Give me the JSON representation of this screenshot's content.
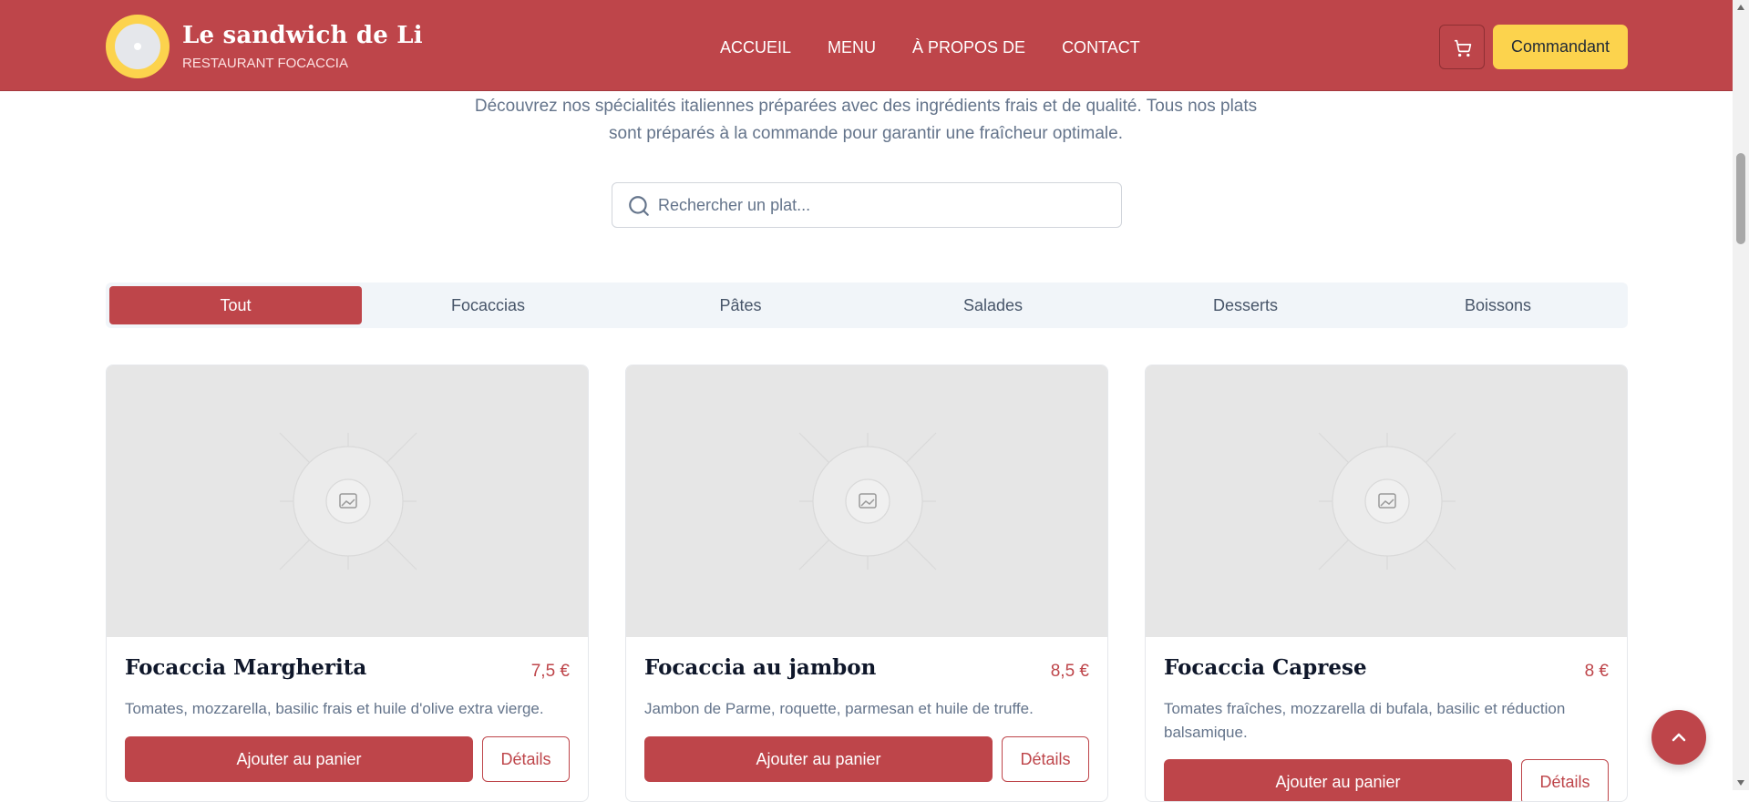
{
  "brand": {
    "title": "Le sandwich de Li",
    "subtitle": "RESTAURANT FOCACCIA"
  },
  "nav": [
    "ACCUEIL",
    "MENU",
    "À PROPOS DE",
    "CONTACT"
  ],
  "header": {
    "cart_icon": "shopping-cart-icon",
    "order_label": "Commandant"
  },
  "intro": "Découvrez nos spécialités italiennes préparées avec des ingrédients frais et de qualité. Tous nos plats sont préparés à la commande pour garantir une fraîcheur optimale.",
  "search": {
    "placeholder": "Rechercher un plat...",
    "value": "",
    "icon": "search-icon"
  },
  "tabs": {
    "active": "Tout",
    "items": [
      "Tout",
      "Focaccias",
      "Pâtes",
      "Salades",
      "Desserts",
      "Boissons"
    ]
  },
  "products": [
    {
      "name": "Focaccia Margherita",
      "price": "7,5 €",
      "description": "Tomates, mozzarella, basilic frais et huile d'olive extra vierge.",
      "add_label": "Ajouter au panier",
      "details_label": "Détails"
    },
    {
      "name": "Focaccia au jambon",
      "price": "8,5 €",
      "description": "Jambon de Parme, roquette, parmesan et huile de truffe.",
      "add_label": "Ajouter au panier",
      "details_label": "Détails"
    },
    {
      "name": "Focaccia Caprese",
      "price": "8 €",
      "description": "Tomates fraîches, mozzarella di bufala, basilic et réduction balsamique.",
      "add_label": "Ajouter au panier",
      "details_label": "Détails"
    }
  ],
  "scroll_top_icon": "chevron-up-icon",
  "colors": {
    "primary": "#be454a",
    "accent": "#fcd34d",
    "muted_text": "#64748b",
    "tab_background": "#f1f5f9",
    "image_placeholder": "#e6e6e6"
  }
}
